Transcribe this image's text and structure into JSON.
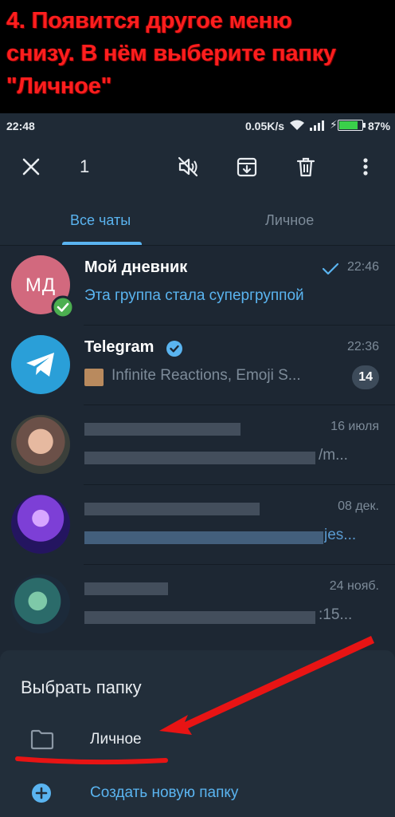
{
  "caption": {
    "lines": [
      "4. Появится другое меню",
      "снизу. В нём выберите папку",
      "\"Личное\""
    ]
  },
  "status_bar": {
    "time": "22:48",
    "network_speed": "0.05K/s",
    "battery_percent": "87%",
    "battery_level": 0.87
  },
  "action_bar": {
    "selected_count": "1",
    "icons": [
      "close-icon",
      "mute-icon",
      "archive-icon",
      "delete-icon",
      "more-vert-icon"
    ]
  },
  "tabs": [
    {
      "label": "Все чаты",
      "active": true
    },
    {
      "label": "Личное",
      "active": false
    }
  ],
  "chats": [
    {
      "name": "Мой дневник",
      "message": "Эта группа стала супергруппой",
      "time": "22:46",
      "avatar_initials": "МД",
      "avatar_color": "#d2697e",
      "read": true,
      "selected": true
    },
    {
      "name": "Telegram",
      "message": "Infinite Reactions, Emoji S...",
      "time": "22:36",
      "unread": "14",
      "verified": true,
      "avatar_color": "#2a9fd8"
    },
    {
      "message_tail": "/m...",
      "time": "16 июля"
    },
    {
      "message_tail": "jes...",
      "time": "08 дек."
    },
    {
      "message_tail": ":15...",
      "time": "24 нояб."
    }
  ],
  "sheet": {
    "title": "Выбрать папку",
    "items": [
      {
        "label": "Личное",
        "icon": "folder-icon"
      },
      {
        "label": "Создать новую папку",
        "icon": "add-circle-icon"
      }
    ]
  },
  "colors": {
    "accent": "#5ab4f0",
    "background": "#1d2733",
    "annotation": "#ff1e1e"
  }
}
